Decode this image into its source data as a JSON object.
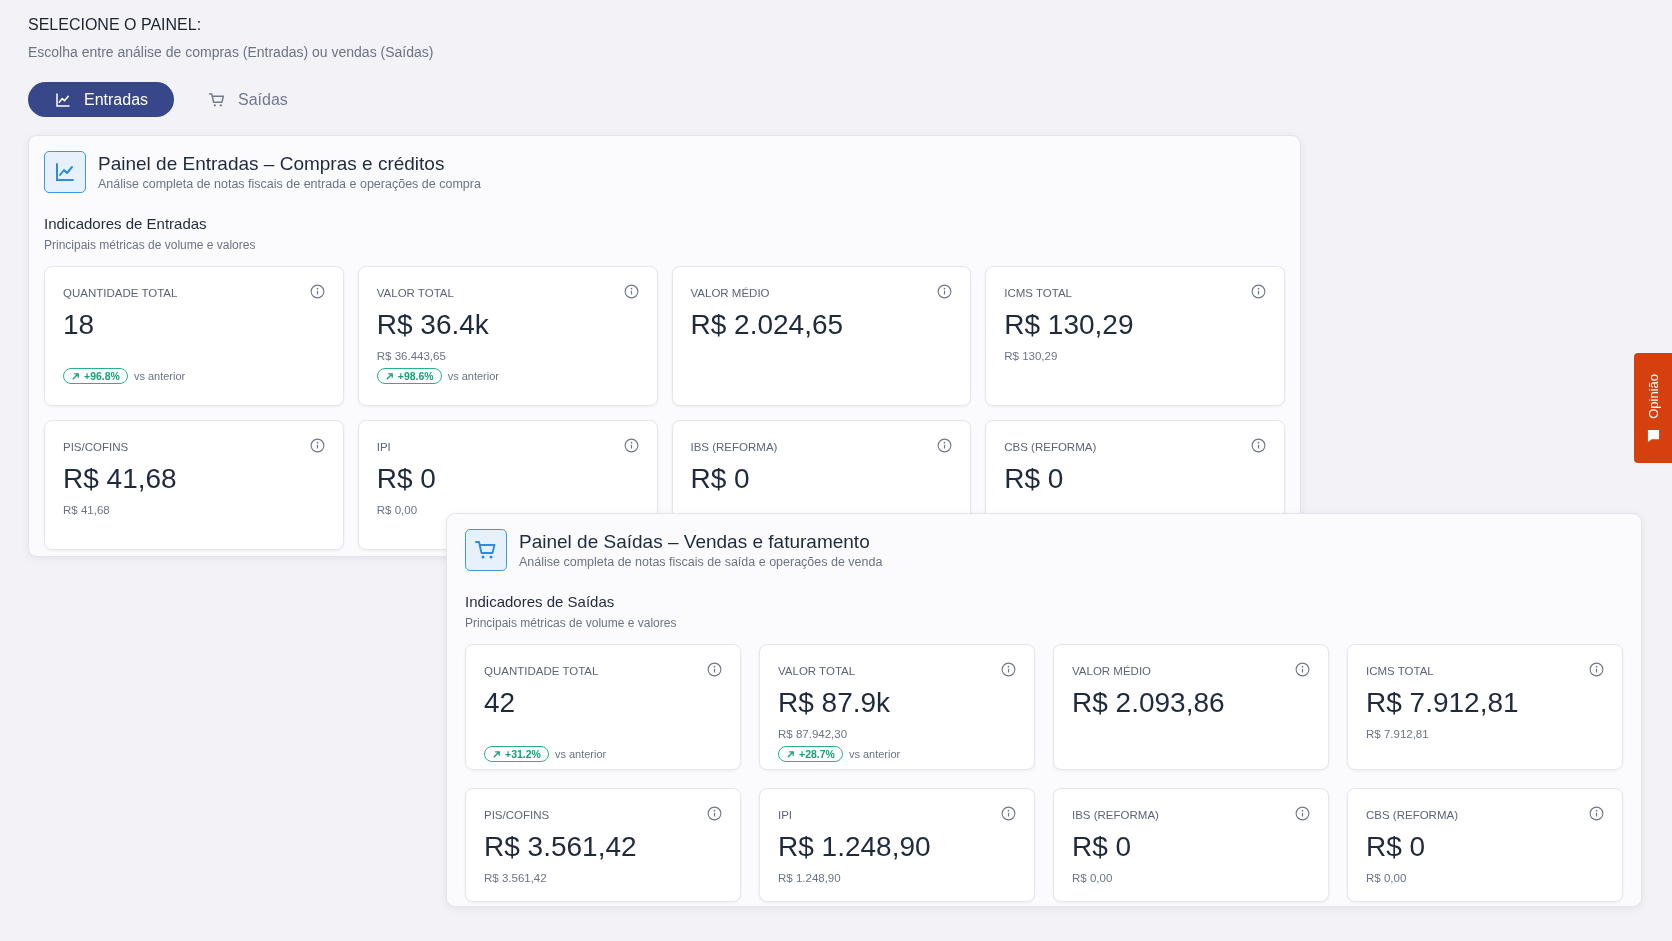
{
  "heading": "SELECIONE O PAINEL:",
  "subheading": "Escolha entre análise de compras (Entradas) ou vendas (Saídas)",
  "tabs": [
    {
      "label": "Entradas",
      "kind": "chart",
      "selected": true
    },
    {
      "label": "Saídas",
      "kind": "cart",
      "selected": false
    }
  ],
  "panels": [
    {
      "kind": "chart",
      "title": "Painel de Entradas – Compras e créditos",
      "subtitle": "Análise completa de notas fiscais de entrada e operações de compra",
      "section_title": "Indicadores de Entradas",
      "section_subtitle": "Principais métricas de volume e valores",
      "metrics": [
        {
          "label": "QUANTIDADE TOTAL",
          "value": "18",
          "trend": "+96.8%",
          "trend_note": "vs anterior"
        },
        {
          "label": "VALOR TOTAL",
          "value": "R$ 36.4k",
          "detail": "R$ 36.443,65",
          "trend": "+98.6%",
          "trend_note": "vs anterior"
        },
        {
          "label": "VALOR MÉDIO",
          "value": "R$ 2.024,65"
        },
        {
          "label": "ICMS TOTAL",
          "value": "R$ 130,29",
          "detail": "R$ 130,29"
        },
        {
          "label": "PIS/COFINS",
          "value": "R$ 41,68",
          "detail": "R$ 41,68"
        },
        {
          "label": "IPI",
          "value": "R$ 0",
          "detail": "R$ 0,00"
        },
        {
          "label": "IBS (REFORMA)",
          "value": "R$ 0"
        },
        {
          "label": "CBS (REFORMA)",
          "value": "R$ 0"
        }
      ]
    },
    {
      "kind": "cart",
      "title": "Painel de Saídas – Vendas e faturamento",
      "subtitle": "Análise completa de notas fiscais de saída e operações de venda",
      "section_title": "Indicadores de Saídas",
      "section_subtitle": "Principais métricas de volume e valores",
      "metrics": [
        {
          "label": "QUANTIDADE TOTAL",
          "value": "42",
          "trend": "+31.2%",
          "trend_note": "vs anterior"
        },
        {
          "label": "VALOR TOTAL",
          "value": "R$ 87.9k",
          "detail": "R$ 87.942,30",
          "trend": "+28.7%",
          "trend_note": "vs anterior"
        },
        {
          "label": "VALOR MÉDIO",
          "value": "R$ 2.093,86"
        },
        {
          "label": "ICMS TOTAL",
          "value": "R$ 7.912,81",
          "detail": "R$ 7.912,81"
        },
        {
          "label": "PIS/COFINS",
          "value": "R$ 3.561,42",
          "detail": "R$ 3.561,42"
        },
        {
          "label": "IPI",
          "value": "R$ 1.248,90",
          "detail": "R$ 1.248,90"
        },
        {
          "label": "IBS (REFORMA)",
          "value": "R$ 0",
          "detail": "R$ 0,00"
        },
        {
          "label": "CBS (REFORMA)",
          "value": "R$ 0",
          "detail": "R$ 0,00"
        }
      ]
    }
  ],
  "feedback_tab": {
    "label": "Opinião"
  }
}
